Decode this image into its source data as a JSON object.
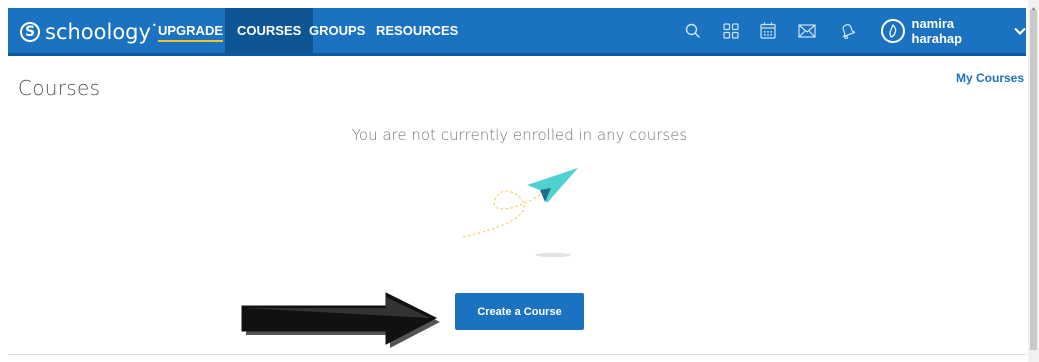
{
  "navbar": {
    "logo_mark": "S",
    "logo_text": "schoology",
    "links": {
      "upgrade": "UPGRADE",
      "courses": "COURSES",
      "groups": "GROUPS",
      "resources": "RESOURCES"
    },
    "icons": [
      "search-icon",
      "apps-grid-icon",
      "calendar-icon",
      "mail-icon",
      "notifications-icon"
    ],
    "user_name": "namira harahap"
  },
  "page": {
    "title": "Courses",
    "my_courses_link": "My Courses",
    "empty_message": "You are not currently enrolled in any courses",
    "create_button": "Create a Course"
  },
  "colors": {
    "brand_blue": "#1a72c0",
    "active_tab": "#0e5594",
    "upgrade_underline": "#f6c32c",
    "plane": "#4fd1d0"
  }
}
